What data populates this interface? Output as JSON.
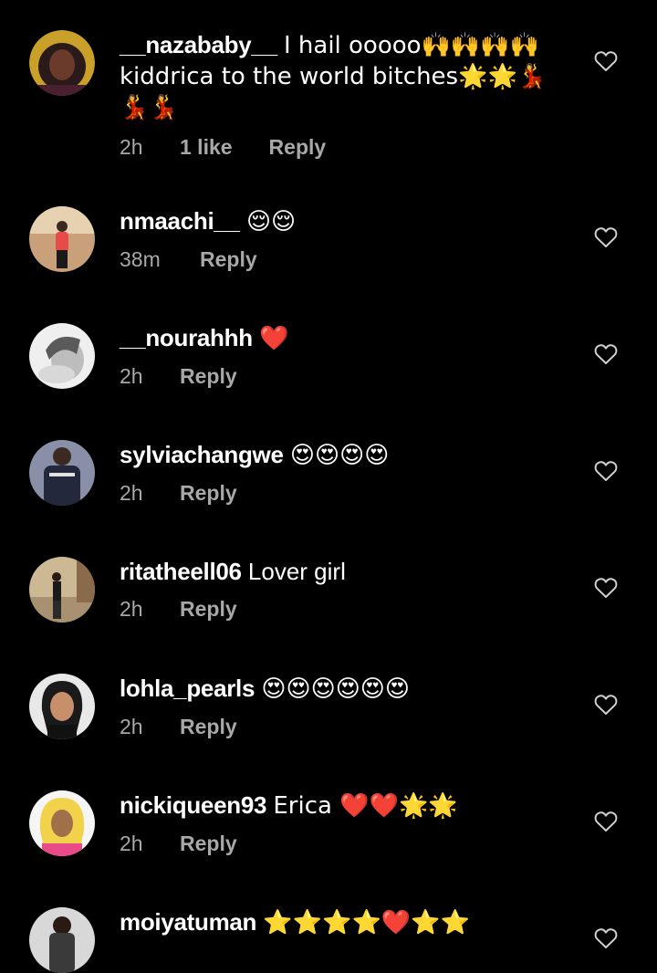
{
  "comments": [
    {
      "username": "__nazababy__",
      "text": "I hail ooooo🙌🙌🙌🙌 kiddrica to the world bitches🌟🌟💃💃💃",
      "time": "2h",
      "likes": "1 like",
      "reply": "Reply",
      "avatar_color": "#5a2a3a"
    },
    {
      "username": "nmaachi__",
      "text": "😌😌",
      "time": "38m",
      "likes": "",
      "reply": "Reply",
      "avatar_color": "#c9a07a"
    },
    {
      "username": "__nourahhh",
      "text": "❤️",
      "time": "2h",
      "likes": "",
      "reply": "Reply",
      "avatar_color": "#d8d8d8"
    },
    {
      "username": "sylviachangwe",
      "text": "😍😍😍😍",
      "time": "2h",
      "likes": "",
      "reply": "Reply",
      "avatar_color": "#2a2f44"
    },
    {
      "username": "ritatheell06",
      "text": "Lover girl",
      "time": "2h",
      "likes": "",
      "reply": "Reply",
      "avatar_color": "#b8a07a"
    },
    {
      "username": "lohla_pearls",
      "text": "😍😍😍😍😍😍",
      "time": "2h",
      "likes": "",
      "reply": "Reply",
      "avatar_color": "#e5e5e5"
    },
    {
      "username": "nickiqueen93",
      "text": "Erica ❤️❤️🌟🌟",
      "time": "2h",
      "likes": "",
      "reply": "Reply",
      "avatar_color": "#f4d35e"
    },
    {
      "username": "moiyatuman",
      "text": "⭐⭐⭐⭐❤️⭐⭐",
      "time": "",
      "likes": "",
      "reply": "",
      "avatar_color": "#3a3a3a"
    }
  ],
  "icons": {
    "like": "heart-outline-icon"
  },
  "colors": {
    "background": "#000000",
    "text": "#ffffff",
    "meta": "#a8a8a8"
  }
}
